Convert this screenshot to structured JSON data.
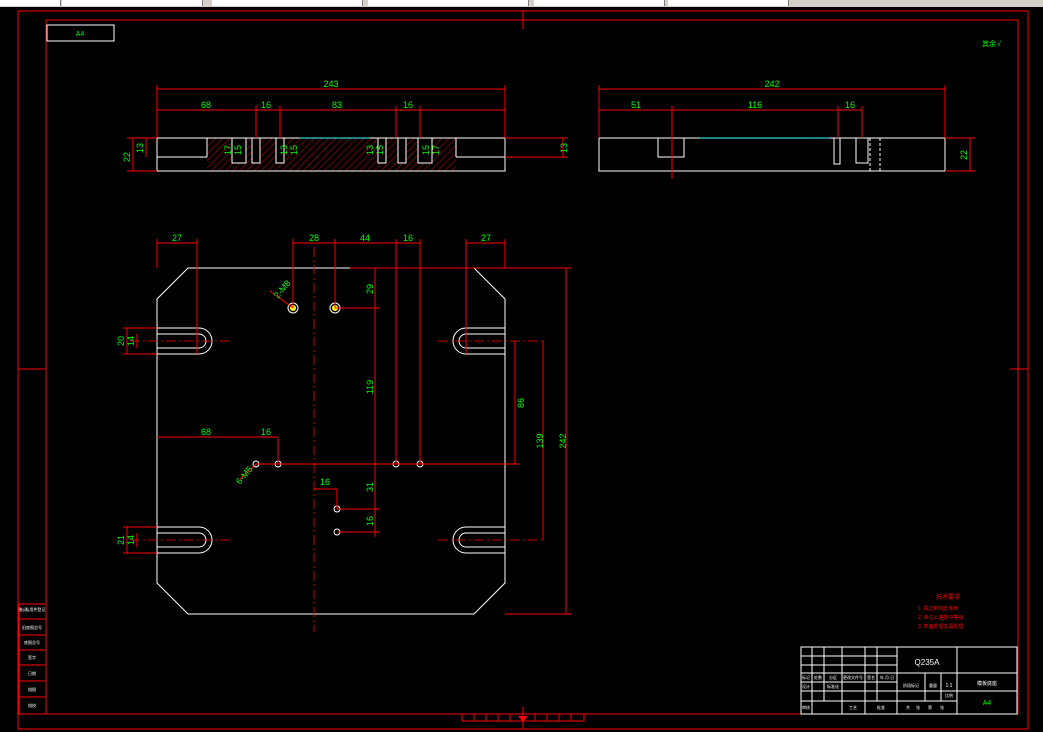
{
  "sheet": {
    "size_label": "A4",
    "top_right_mark": "其余",
    "roughness_mark": "√"
  },
  "top_view_left": {
    "dims": {
      "overall": "243",
      "d68": "68",
      "d16a": "16",
      "d83": "83",
      "d16b": "16",
      "h22": "22",
      "h13l": "13",
      "h13r": "13",
      "s17a": "17",
      "s15a": "15",
      "s13a": "13",
      "s15b": "15",
      "s13b": "13",
      "s15c": "15",
      "s15d": "15",
      "s17b": "17"
    }
  },
  "top_view_right": {
    "dims": {
      "overall": "242",
      "d51": "51",
      "d116": "116",
      "d16": "16",
      "h22": "22"
    }
  },
  "plan_view": {
    "dims": {
      "d27l": "27",
      "d28": "28",
      "d44": "44",
      "d16t": "16",
      "d27r": "27",
      "slot20": "20",
      "slot14a": "14",
      "slot21": "21",
      "slot14b": "14",
      "d29": "29",
      "d119": "119",
      "d68": "68",
      "d16m": "16",
      "d86": "86",
      "d139": "139",
      "d242": "242",
      "d16s": "16",
      "d31": "31",
      "d16v": "16",
      "hole_a": "2-M8",
      "hole_b": "6-M5"
    }
  },
  "tech_notes": {
    "title": "技术要求",
    "items": [
      "1. 锐边倒钝去毛刺",
      "2. 未注公差按中等级",
      "3. 表面处理发黑处理"
    ]
  },
  "title_block": {
    "material": "Q235A",
    "part_name": "模板底座",
    "size": "A4",
    "scale": "1:1",
    "left_cells": [
      "标记",
      "处数",
      "分区",
      "更改文件号",
      "签名",
      "年.月.日"
    ],
    "bottom_cells": [
      "设计",
      "标准化",
      "阶段标记",
      "重量",
      "比例"
    ],
    "bottom_row2": [
      "审核",
      "工艺",
      "批准",
      "共",
      "张",
      "第",
      "张"
    ]
  },
  "side_table": {
    "rows": [
      "借(通)用件登记",
      "旧底图总号",
      "底图总号",
      "签字",
      "日期",
      "描图",
      "描校"
    ]
  }
}
